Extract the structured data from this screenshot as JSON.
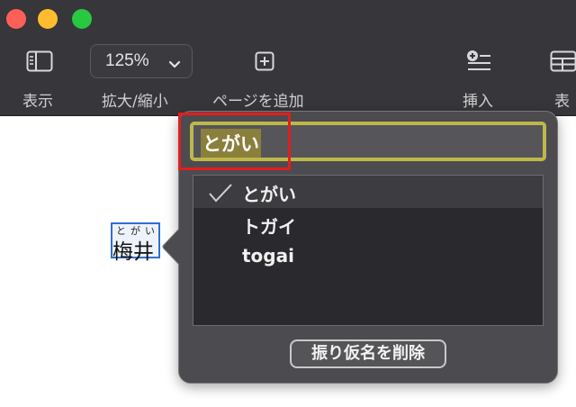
{
  "toolbar": {
    "view_label": "表示",
    "zoom_label": "拡大/縮小",
    "zoom_value": "125%",
    "add_page_label": "ページを追加",
    "insert_label": "挿入",
    "table_label": "表"
  },
  "document": {
    "ruby_text": "とがい",
    "base_text": "梅井"
  },
  "popover": {
    "ruby_value": "とがい",
    "candidates": [
      {
        "label": "とがい",
        "checked": true
      },
      {
        "label": "トガイ",
        "checked": false
      },
      {
        "label": "togai",
        "checked": false
      }
    ],
    "remove_button": "振り仮名を削除"
  },
  "colors": {
    "highlight": "#e31d1d",
    "field_border": "#bdb84a",
    "selection_border": "#2f6fcf"
  }
}
